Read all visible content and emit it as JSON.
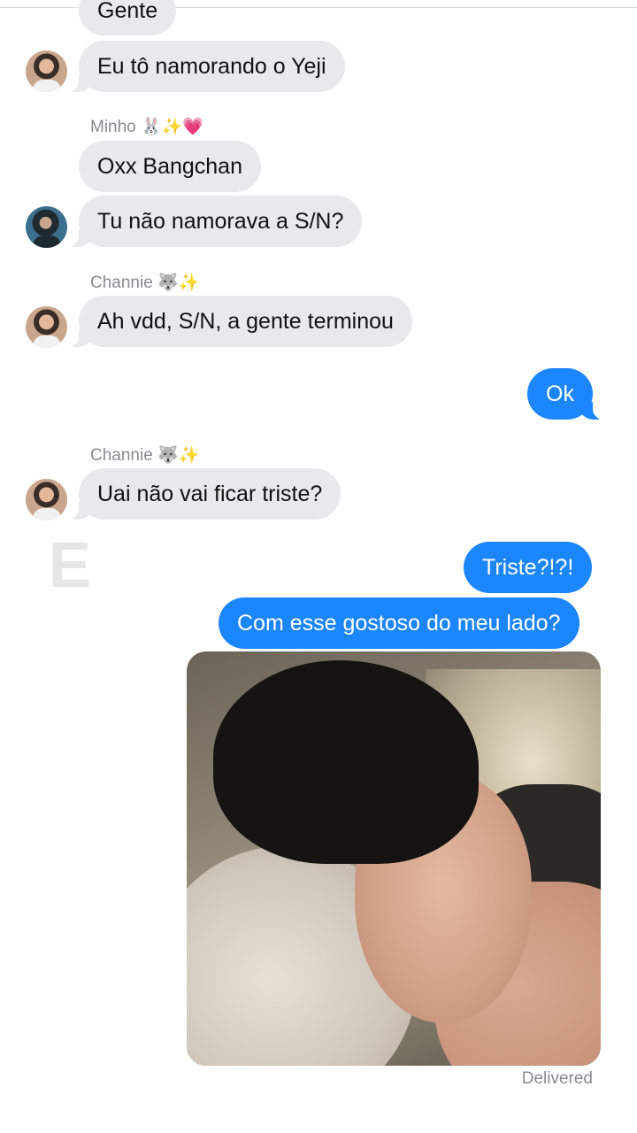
{
  "messages": [
    {
      "text": "Gente",
      "dir": "in"
    },
    {
      "text": "Eu tô namorando o Yeji",
      "dir": "in"
    },
    {
      "sender": "Minho 🐰✨💗"
    },
    {
      "text": "Oxx Bangchan",
      "dir": "in"
    },
    {
      "text": "Tu não namorava a S/N?",
      "dir": "in"
    },
    {
      "sender": "Channie 🐺✨"
    },
    {
      "text": "Ah vdd, S/N, a gente terminou",
      "dir": "in"
    },
    {
      "text": "Ok",
      "dir": "out"
    },
    {
      "sender": "Channie 🐺✨"
    },
    {
      "text": "Uai não vai ficar triste?",
      "dir": "in"
    },
    {
      "text": "Triste?!?!",
      "dir": "out"
    },
    {
      "text": "Com esse gostoso do meu lado?",
      "dir": "out"
    }
  ],
  "watermark": "E",
  "status": "Delivered"
}
